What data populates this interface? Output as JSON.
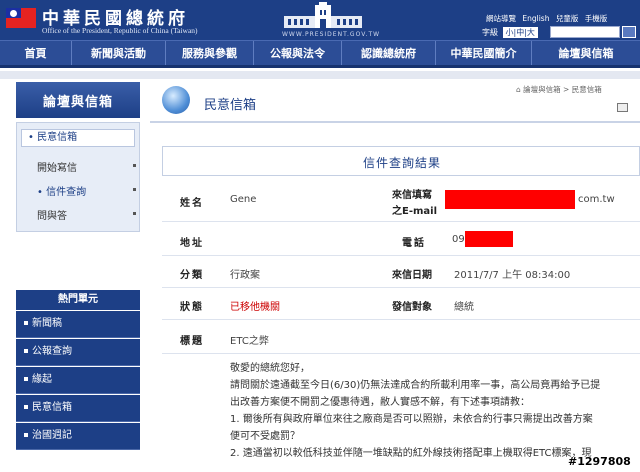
{
  "header": {
    "title": "中華民國總統府",
    "subtitle": "Office of the President, Republic of China (Taiwan)",
    "url": "WWW.PRESIDENT.GOV.TW",
    "utility_links": [
      "網站導覽",
      "English",
      "兒童版",
      "手機版"
    ],
    "font_size_label": "字級",
    "font_size_options": "小|中|大"
  },
  "nav": [
    "首頁",
    "新聞與活動",
    "服務與參觀",
    "公報與法令",
    "認識總統府",
    "中華民國簡介",
    "論壇與信箱"
  ],
  "sidebar": {
    "heading": "論壇與信箱",
    "current": "民意信箱",
    "items": [
      "開始寫信",
      "信件查詢",
      "問與答"
    ],
    "hot_heading": "熱門單元",
    "hot_items": [
      "新聞稿",
      "公報查詢",
      "緣起",
      "民意信箱",
      "治國週記"
    ]
  },
  "page": {
    "title": "民意信箱",
    "breadcrumb": "論壇與信箱 > 民意信箱",
    "result_title": "信件查詢結果"
  },
  "record": {
    "name_label": "姓名",
    "name_value": "Gene",
    "email_label_1": "來信填寫",
    "email_label_2": "之E-mail",
    "email_suffix": "com.tw",
    "addr_label": "地址",
    "phone_label": "電話",
    "phone_prefix": "09",
    "category_label": "分類",
    "category_value": "行政案",
    "date_label": "來信日期",
    "date_value": "2011/7/7 上午 08:34:00",
    "status_label": "狀態",
    "status_value": "已移他機關",
    "target_label": "發信對象",
    "target_value": "總統",
    "subject_label": "標題",
    "subject_value": "ETC之弊"
  },
  "letter": [
    "敬愛的總統您好，",
    "請問關於遠通截至今日(6/30)仍無法達成合約所載利用率一事，高公局竟再給予已提",
    "出改善方案便不開罰之優惠待遇，敝人實感不解，有下述事項請教：",
    "1. 爾後所有與政府單位來往之廠商是否可以照辦，未依合約行事只需提出改善方案",
    "便可不受處罰？",
    "2. 遠通當初以較低科技並伴隨一堆缺點的紅外線技術搭配車上機取得ETC標案，現"
  ],
  "watermark": "#1297808",
  "colors": {
    "brand": "#1d3f86",
    "status_red": "#cc0000",
    "redaction": "#ff0000"
  }
}
